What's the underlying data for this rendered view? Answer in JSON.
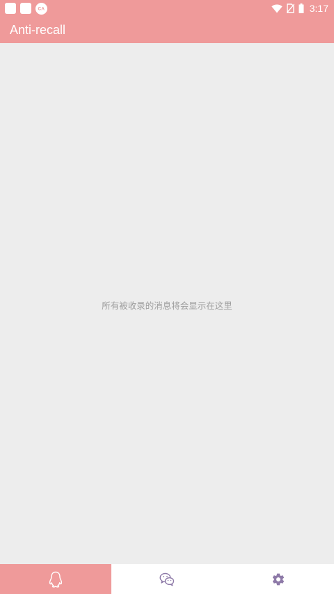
{
  "status_bar": {
    "time": "3:17",
    "notification_icons": [
      "app-notification-icon",
      "app-notification-icon",
      "ca-badge-icon"
    ],
    "system_icons": [
      "wifi-icon",
      "no-sim-icon",
      "battery-icon"
    ]
  },
  "app_bar": {
    "title": "Anti-recall"
  },
  "main": {
    "empty_message": "所有被收录的消息将会显示在这里"
  },
  "bottom_nav": {
    "items": [
      {
        "icon": "qq-penguin-icon",
        "active": true
      },
      {
        "icon": "wechat-icon",
        "active": false
      },
      {
        "icon": "gear-icon",
        "active": false
      }
    ]
  },
  "colors": {
    "accent": "#ef9a9a",
    "background": "#ededed",
    "icon_inactive": "#8e7aa8",
    "empty_text": "#9e9e9e"
  }
}
